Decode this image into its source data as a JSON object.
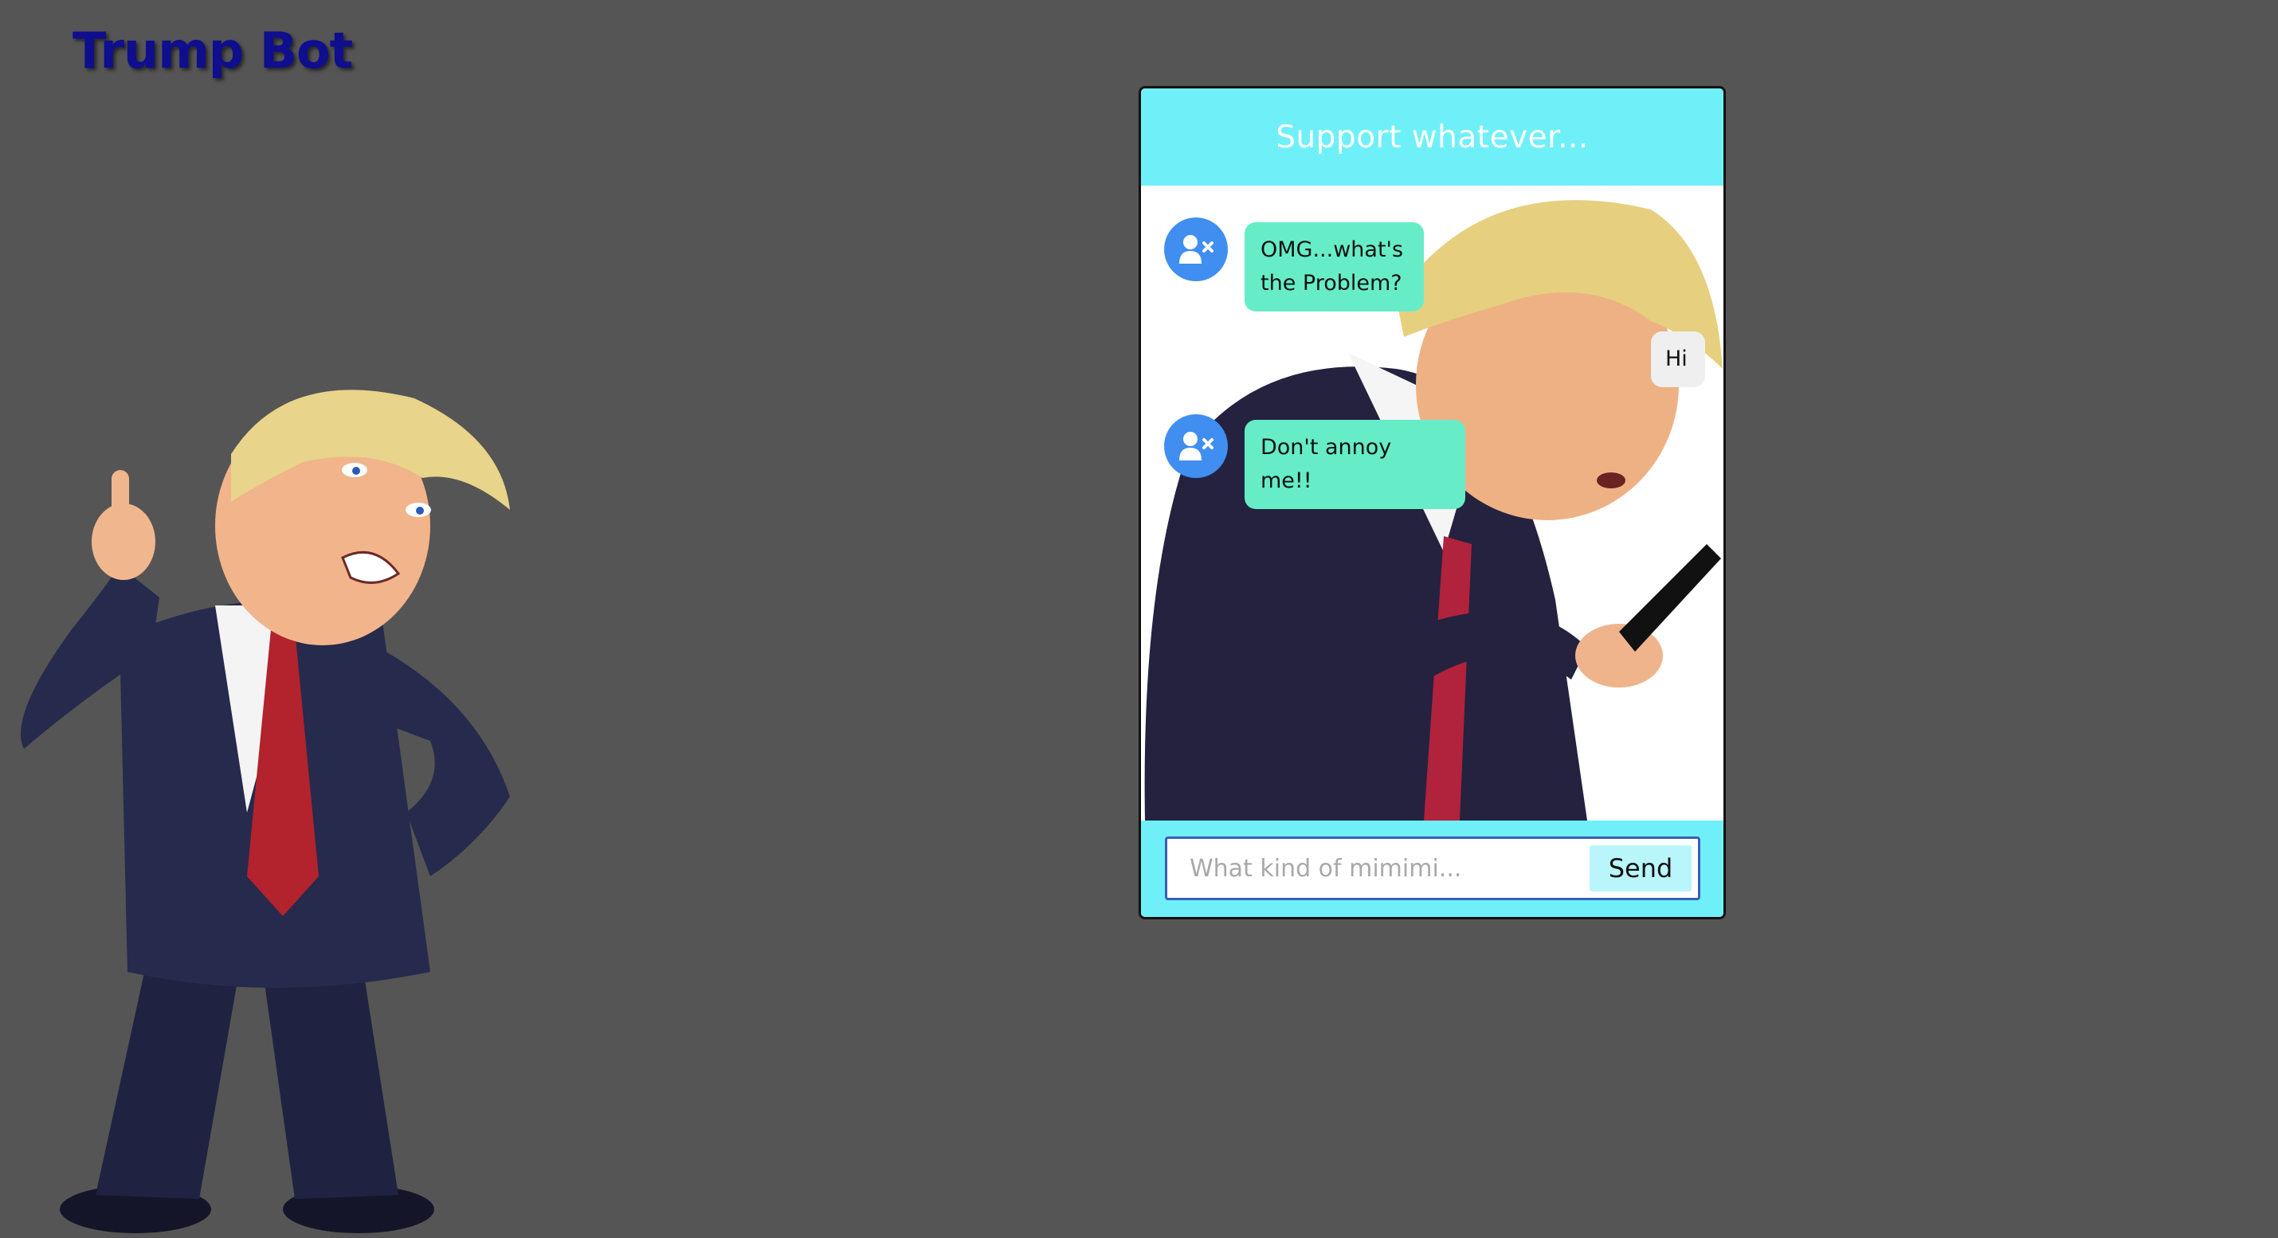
{
  "page": {
    "title": "Trump Bot"
  },
  "chat": {
    "header_title": "Support whatever...",
    "messages": [
      {
        "sender": "bot",
        "text_lines": [
          "OMG...what's",
          "the Problem?"
        ],
        "avatar_icon": "user-x-icon"
      },
      {
        "sender": "user",
        "text_lines": [
          "Hi"
        ]
      },
      {
        "sender": "bot",
        "text_lines": [
          "Don't annoy me!!"
        ],
        "avatar_icon": "user-x-icon"
      }
    ],
    "input_placeholder": "What kind of mimimi...",
    "send_label": "Send"
  },
  "colors": {
    "page_background": "#555555",
    "title": "#0e0e8e",
    "header_background": "#6ff0f9",
    "bot_bubble": "#66edc8",
    "user_bubble": "#efefef",
    "avatar": "#3f8ef0",
    "send_button": "#b9f6fc"
  }
}
